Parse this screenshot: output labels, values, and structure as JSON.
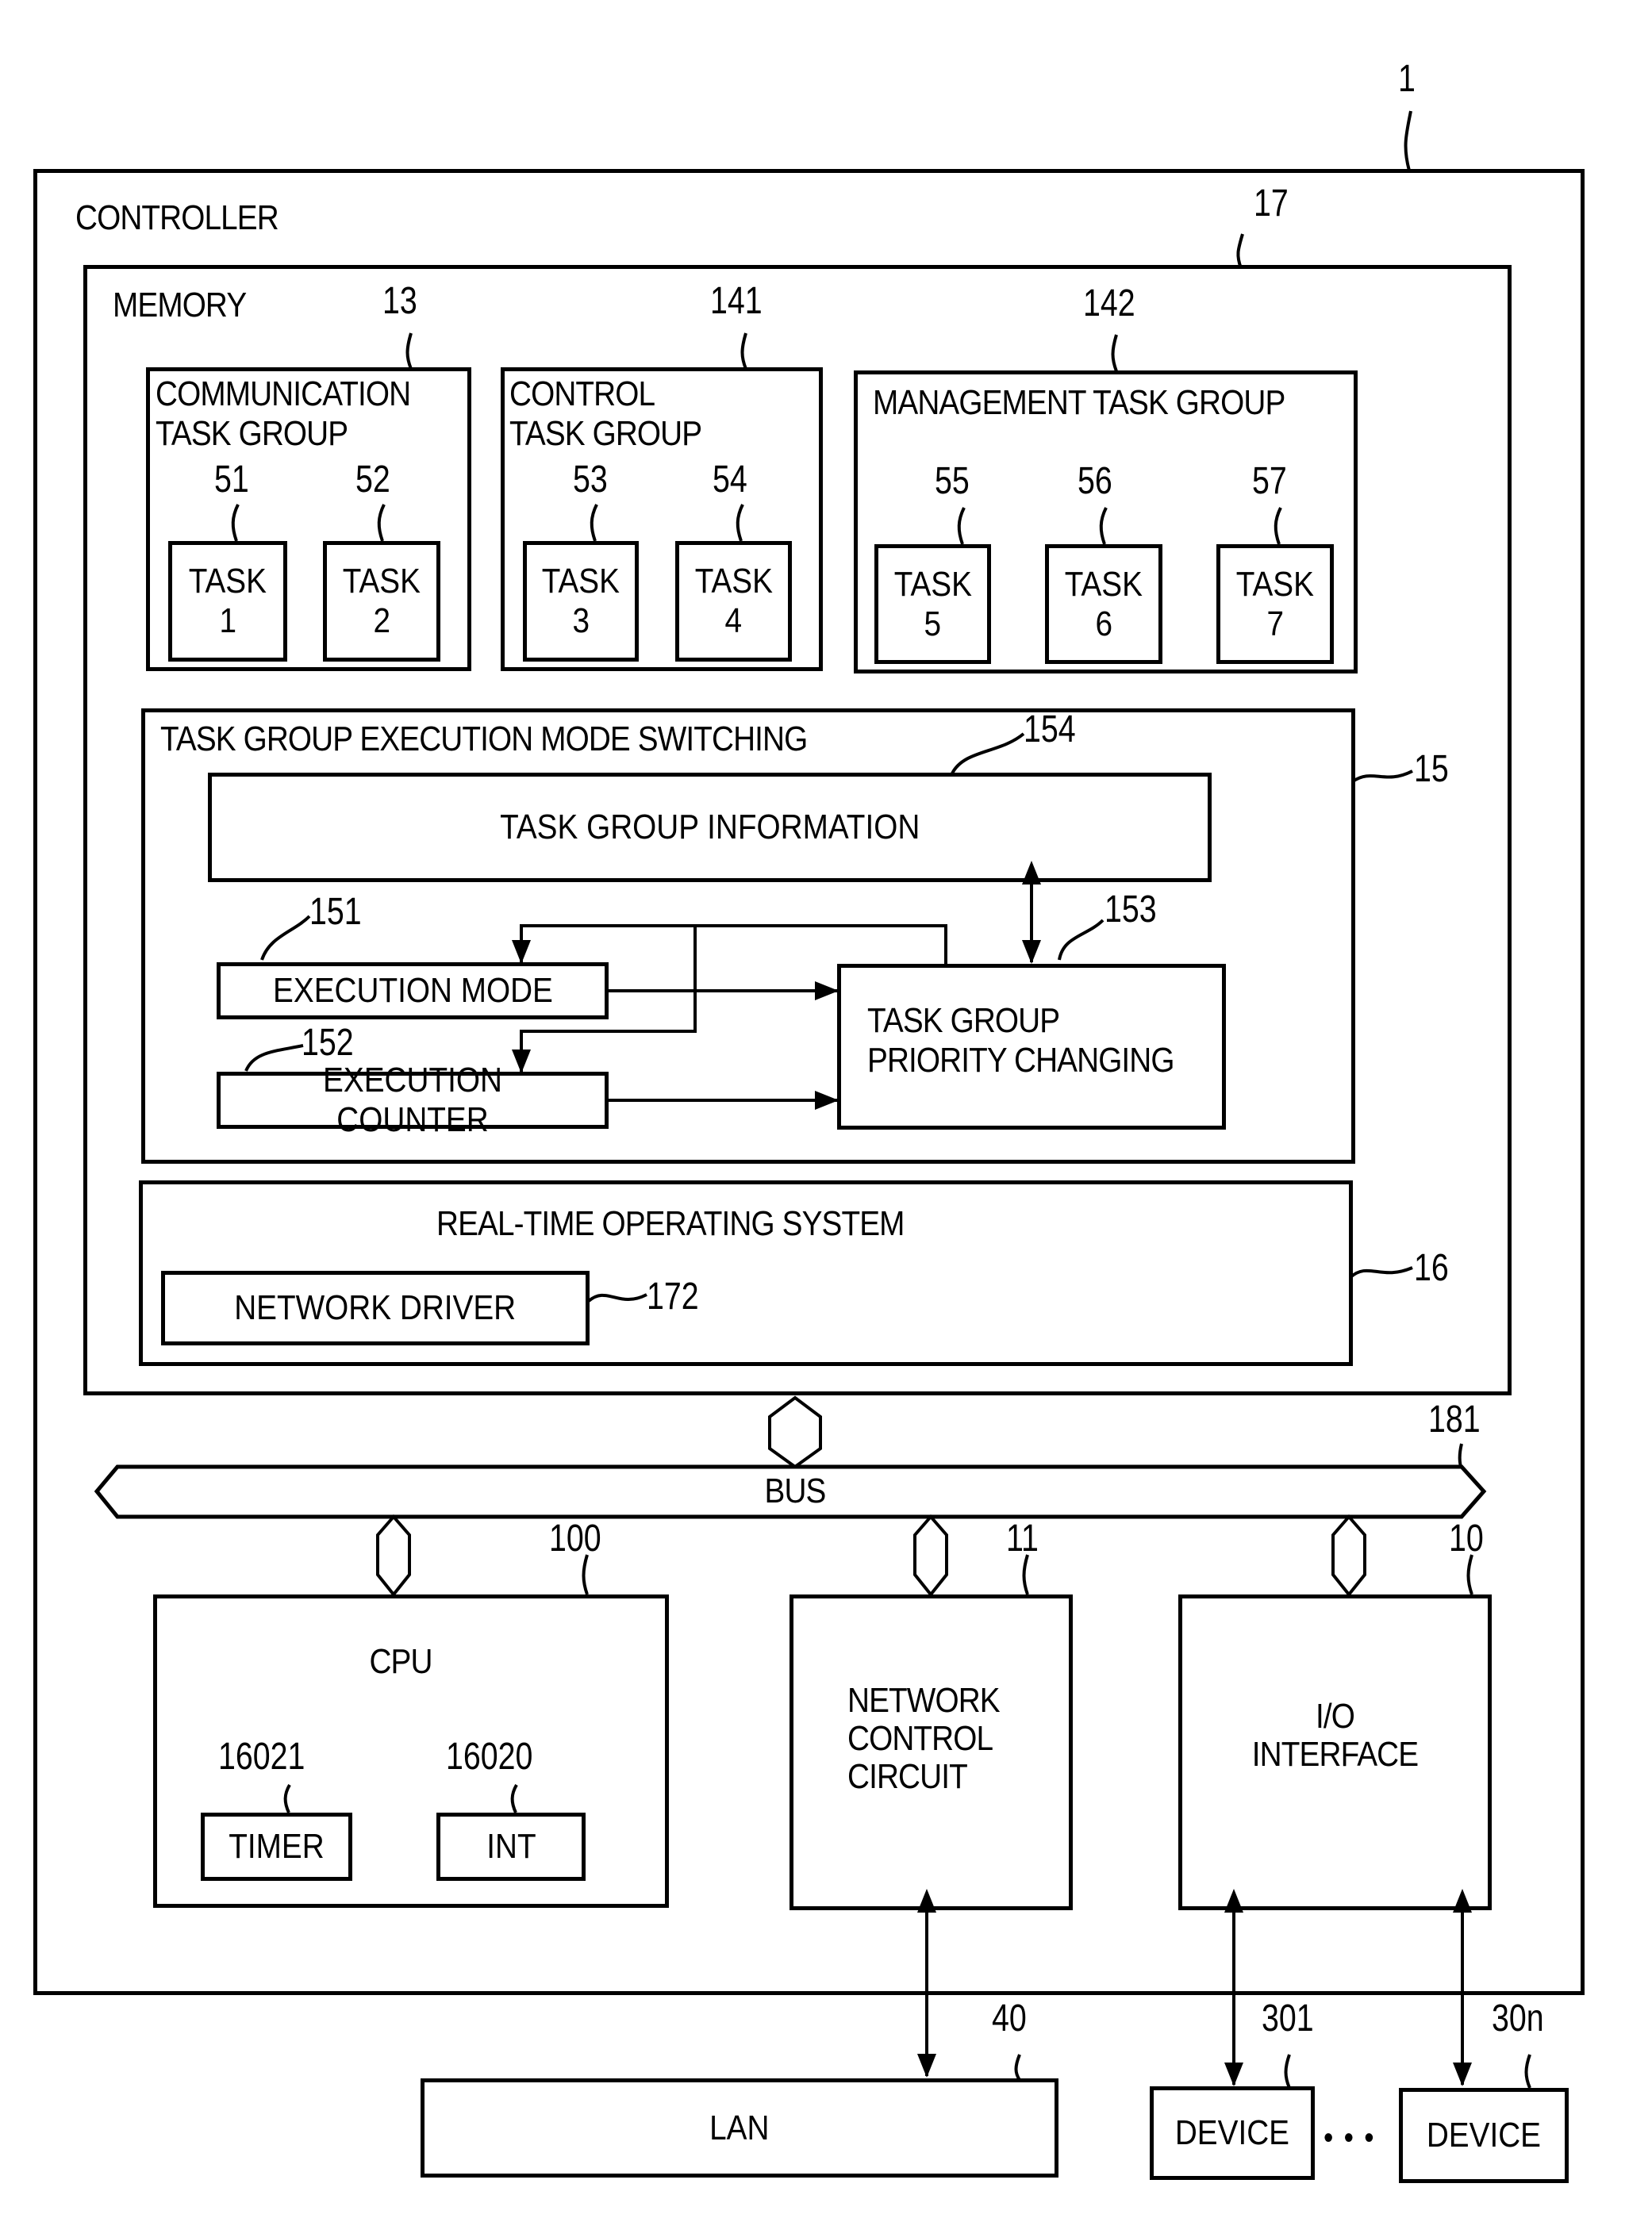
{
  "figure": {
    "system_ref": "1",
    "controller": {
      "label": "CONTROLLER"
    },
    "memory": {
      "label": "MEMORY",
      "ref": "17"
    },
    "task_groups": [
      {
        "label": "COMMUNICATION\nTASK GROUP",
        "ref": "13",
        "tasks": [
          {
            "label": "TASK",
            "num": "1",
            "ref": "51"
          },
          {
            "label": "TASK",
            "num": "2",
            "ref": "52"
          }
        ]
      },
      {
        "label": "CONTROL\nTASK GROUP",
        "ref": "141",
        "tasks": [
          {
            "label": "TASK",
            "num": "3",
            "ref": "53"
          },
          {
            "label": "TASK",
            "num": "4",
            "ref": "54"
          }
        ]
      },
      {
        "label": "MANAGEMENT TASK GROUP",
        "ref": "142",
        "tasks": [
          {
            "label": "TASK",
            "num": "5",
            "ref": "55"
          },
          {
            "label": "TASK",
            "num": "6",
            "ref": "56"
          },
          {
            "label": "TASK",
            "num": "7",
            "ref": "57"
          }
        ]
      }
    ],
    "mode_switching": {
      "label": "TASK GROUP EXECUTION MODE SWITCHING",
      "ref": "15",
      "task_group_info": {
        "label": "TASK GROUP INFORMATION",
        "ref": "154"
      },
      "execution_mode": {
        "label": "EXECUTION MODE",
        "ref": "151"
      },
      "execution_counter": {
        "label": "EXECUTION COUNTER",
        "ref": "152"
      },
      "priority_changing": {
        "label": "TASK GROUP\nPRIORITY CHANGING",
        "ref": "153"
      }
    },
    "rtos": {
      "label": "REAL-TIME OPERATING SYSTEM",
      "ref": "16",
      "network_driver": {
        "label": "NETWORK DRIVER",
        "ref": "172"
      }
    },
    "bus": {
      "label": "BUS",
      "ref": "181"
    },
    "cpu": {
      "label": "CPU",
      "ref": "100",
      "timer": {
        "label": "TIMER",
        "ref": "16021"
      },
      "int": {
        "label": "INT",
        "ref": "16020"
      }
    },
    "network_control_circuit": {
      "label": "NETWORK\nCONTROL\nCIRCUIT",
      "ref": "11"
    },
    "io_interface": {
      "label": "I/O\nINTERFACE",
      "ref": "10"
    },
    "lan": {
      "label": "LAN",
      "ref": "40"
    },
    "devices": [
      {
        "label": "DEVICE",
        "ref": "301"
      },
      {
        "label": "DEVICE",
        "ref": "30n"
      }
    ],
    "ellipsis": "• • •"
  }
}
